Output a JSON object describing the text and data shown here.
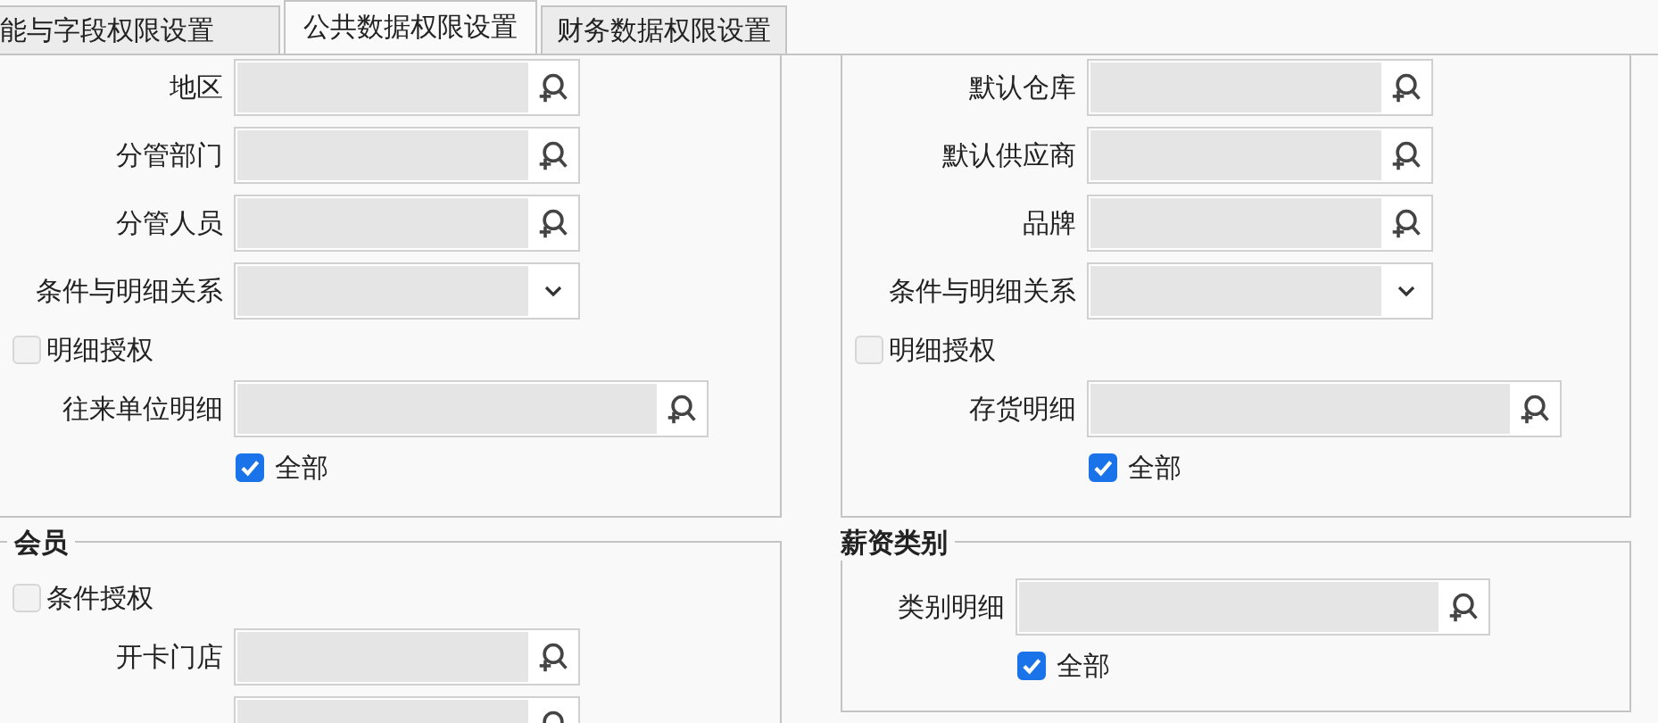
{
  "tabs": [
    {
      "label": "能与字段权限设置",
      "selected": false
    },
    {
      "label": "公共数据权限设置",
      "selected": true
    },
    {
      "label": "财务数据权限设置",
      "selected": false
    }
  ],
  "columns": [
    {
      "groups": [
        {
          "fields": [
            {
              "kind": "lookup",
              "label": "地区"
            },
            {
              "kind": "lookup",
              "label": "分管部门"
            },
            {
              "kind": "lookup",
              "label": "分管人员"
            },
            {
              "kind": "dropdown",
              "label": "条件与明细关系"
            },
            {
              "kind": "checkbox",
              "label": "明细授权",
              "checked": false
            },
            {
              "kind": "lookup_wide",
              "label": "往来单位明细"
            },
            {
              "kind": "checkbox_indented",
              "label": "全部",
              "checked": true
            }
          ]
        },
        {
          "title": "会员",
          "fields": [
            {
              "kind": "checkbox",
              "label": "条件授权",
              "checked": false
            },
            {
              "kind": "lookup",
              "label": "开卡门店"
            },
            {
              "kind": "lookup"
            }
          ]
        }
      ]
    },
    {
      "groups": [
        {
          "fields": [
            {
              "kind": "lookup",
              "label": "默认仓库"
            },
            {
              "kind": "lookup",
              "label": "默认供应商"
            },
            {
              "kind": "lookup",
              "label": "品牌"
            },
            {
              "kind": "dropdown",
              "label": "条件与明细关系"
            },
            {
              "kind": "checkbox",
              "label": "明细授权",
              "checked": false
            },
            {
              "kind": "lookup_wide",
              "label": "存货明细"
            },
            {
              "kind": "checkbox_indented",
              "label": "全部",
              "checked": true
            }
          ]
        },
        {
          "title": "薪资类别",
          "fields": [
            {
              "kind": "lookup_wide",
              "label": "类别明细"
            },
            {
              "kind": "checkbox_indented",
              "label": "全部",
              "checked": true
            }
          ]
        }
      ]
    }
  ]
}
